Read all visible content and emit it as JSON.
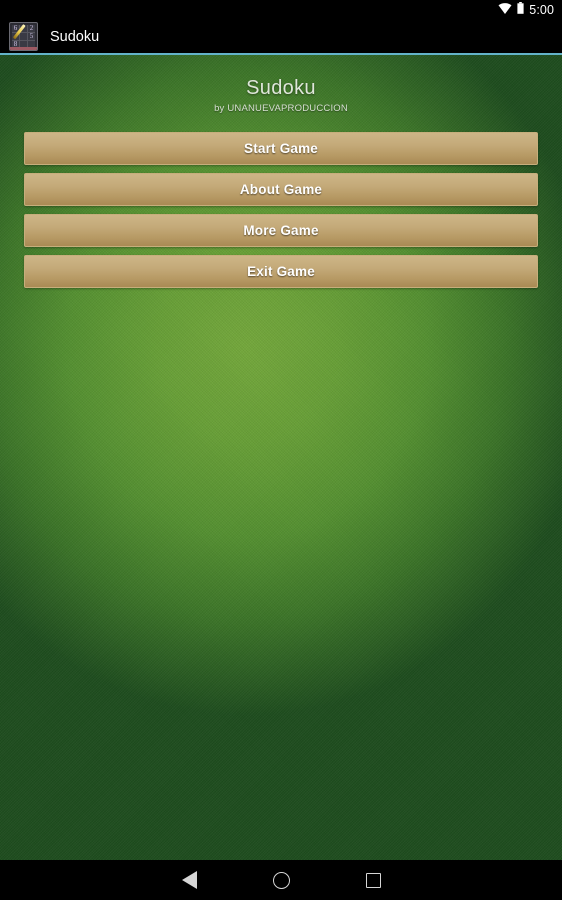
{
  "status_bar": {
    "time": "5:00",
    "wifi_icon": "wifi-icon",
    "battery_icon": "battery-icon"
  },
  "action_bar": {
    "app_title": "Sudoku",
    "app_icon": "sudoku-grid-icon",
    "icon_cells": [
      "6",
      "",
      "2",
      "",
      "",
      "5",
      "8",
      "",
      ""
    ],
    "divider_color": "#63b3c9"
  },
  "main": {
    "title": "Sudoku",
    "subtitle": "by UNANUEVAPRODUCCION",
    "menu": [
      {
        "label": "Start Game",
        "name": "start-game-button"
      },
      {
        "label": "About Game",
        "name": "about-game-button"
      },
      {
        "label": "More Game",
        "name": "more-game-button"
      },
      {
        "label": "Exit Game",
        "name": "exit-game-button"
      }
    ]
  },
  "nav_bar": {
    "back_label": "Back",
    "home_label": "Home",
    "recents_label": "Recents"
  },
  "colors": {
    "felt_center": "#74a83c",
    "felt_edge": "#1e4d1e",
    "button_top": "#cdb587",
    "button_bottom": "#a98a54",
    "button_border": "#c6ae7c",
    "button_text": "#ffffff",
    "title_text": "#dfe6da",
    "bar_background": "#000000",
    "divider": "#63b3c9"
  }
}
